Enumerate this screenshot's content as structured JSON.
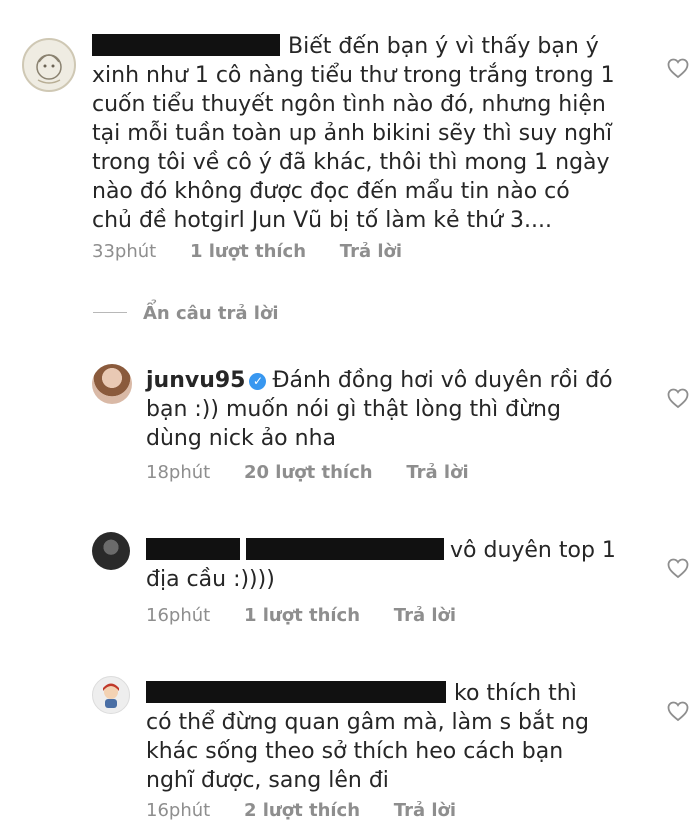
{
  "comments": [
    {
      "lines": [
        "Biết đến bạn ý vì thấy bạn ý",
        "xinh như 1 cô nàng tiểu thư trong trắng trong 1",
        "cuốn tiểu thuyết ngôn tình nào đó, nhưng hiện",
        "tại mỗi tuần toàn up ảnh bikini sẽy thì suy nghĩ",
        "trong tôi về cô ý đã khác, thôi thì mong 1 ngày",
        "nào đó không được đọc đến mẩu tin nào có",
        "chủ đề hotgirl Jun Vũ bị tố làm kẻ thứ 3...."
      ],
      "time": "33phút",
      "likes": "1 lượt thích",
      "reply": "Trả lời"
    },
    {
      "username": "junvu95",
      "verified_icon": "check-badge",
      "lines": [
        "Đánh đồng hơi vô duyên rồi đó",
        "bạn :)) muốn nói gì thật lòng thì đừng",
        "dùng nick ảo nha"
      ],
      "time": "18phút",
      "likes": "20 lượt thích",
      "reply": "Trả lời"
    },
    {
      "lines": [
        "vô duyên top 1",
        "địa cầu :))))"
      ],
      "time": "16phút",
      "likes": "1 lượt thích",
      "reply": "Trả lời"
    },
    {
      "lines": [
        "ko thích thì",
        "có thể đừng quan gâm mà, làm s bắt ng",
        "khác sống theo sở thích heo cách bạn",
        "nghĩ được, sang lên đi"
      ],
      "time": "16phút",
      "likes": "2 lượt thích",
      "reply": "Trả lời"
    }
  ],
  "hide_replies": "Ẩn câu trả lời",
  "icons": {
    "like": "heart-outline-icon",
    "verified": "verified-badge-icon"
  },
  "colors": {
    "text": "#262626",
    "meta": "#8e8e8e",
    "verified": "#3897f0",
    "redaction": "#111111"
  }
}
